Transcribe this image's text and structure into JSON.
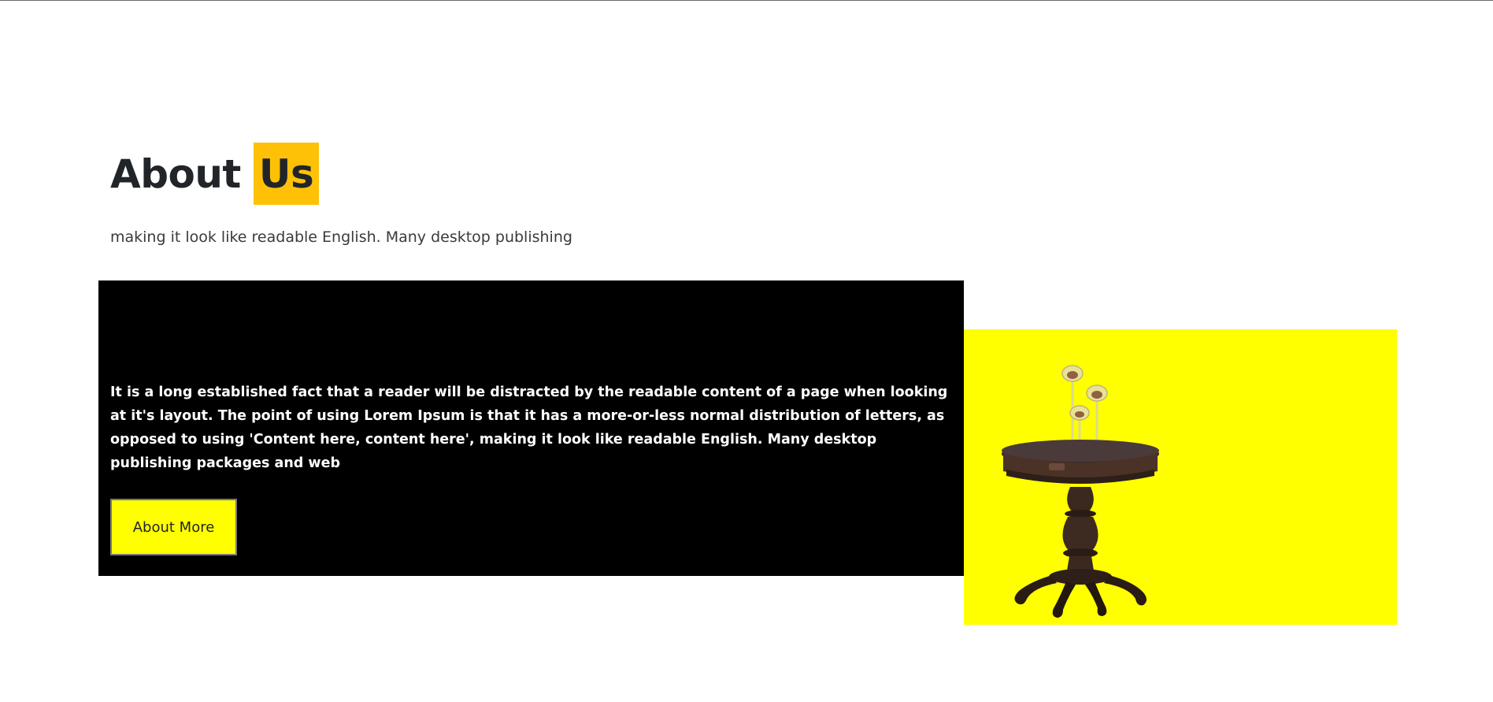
{
  "about": {
    "title_word1": "About",
    "title_word2": "Us",
    "subtitle": "making it look like readable English. Many desktop publishing",
    "body": "It is a long established fact that a reader will be distracted by the readable content of a page when looking at it's layout. The point of using Lorem Ipsum is that it has a more-or-less normal distribution of letters, as opposed to using 'Content here, content here', making it look like readable English. Many desktop publishing packages and web",
    "button_label": "About More"
  },
  "colors": {
    "highlight": "#ffc107",
    "panel_dark": "#000000",
    "panel_accent": "#ffff00",
    "button_bg": "#ffff00"
  },
  "image": {
    "subject": "round-pedestal-table-with-candle-holders"
  }
}
